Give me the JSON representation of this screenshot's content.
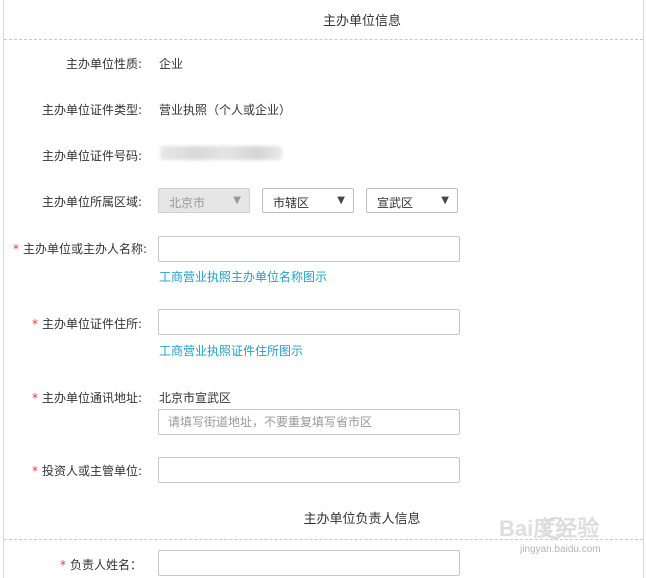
{
  "host_section": {
    "title": "主办单位信息"
  },
  "fields": {
    "nature": {
      "label": "主办单位性质:",
      "value": "企业"
    },
    "cert_type": {
      "label": "主办单位证件类型:",
      "value": "营业执照（个人或企业）"
    },
    "cert_no": {
      "label": "主办单位证件号码:"
    },
    "region": {
      "label": "主办单位所属区域:",
      "province": "北京市",
      "city": "市辖区",
      "district": "宣武区"
    },
    "org_name": {
      "label": "主办单位或主办人名称:",
      "required_mark": "*",
      "value": "",
      "help_link": "工商营业执照主办单位名称图示"
    },
    "cert_address": {
      "label": "主办单位证件住所:",
      "required_mark": "*",
      "value": "",
      "help_link": "工商营业执照证件住所图示"
    },
    "mail_address": {
      "label": "主办单位通讯地址:",
      "required_mark": "*",
      "prefix": "北京市宣武区",
      "placeholder": "请填写街道地址，不要重复填写省市区"
    },
    "investor": {
      "label": "投资人或主管单位:",
      "required_mark": "*",
      "value": ""
    }
  },
  "leader_section": {
    "title": "主办单位负责人信息"
  },
  "leader_fields": {
    "name": {
      "label": "负责人姓名：",
      "required_mark": "*",
      "value": ""
    }
  },
  "watermark": {
    "brand": "Bai度经验",
    "url": "jingyan.baidu.com"
  }
}
